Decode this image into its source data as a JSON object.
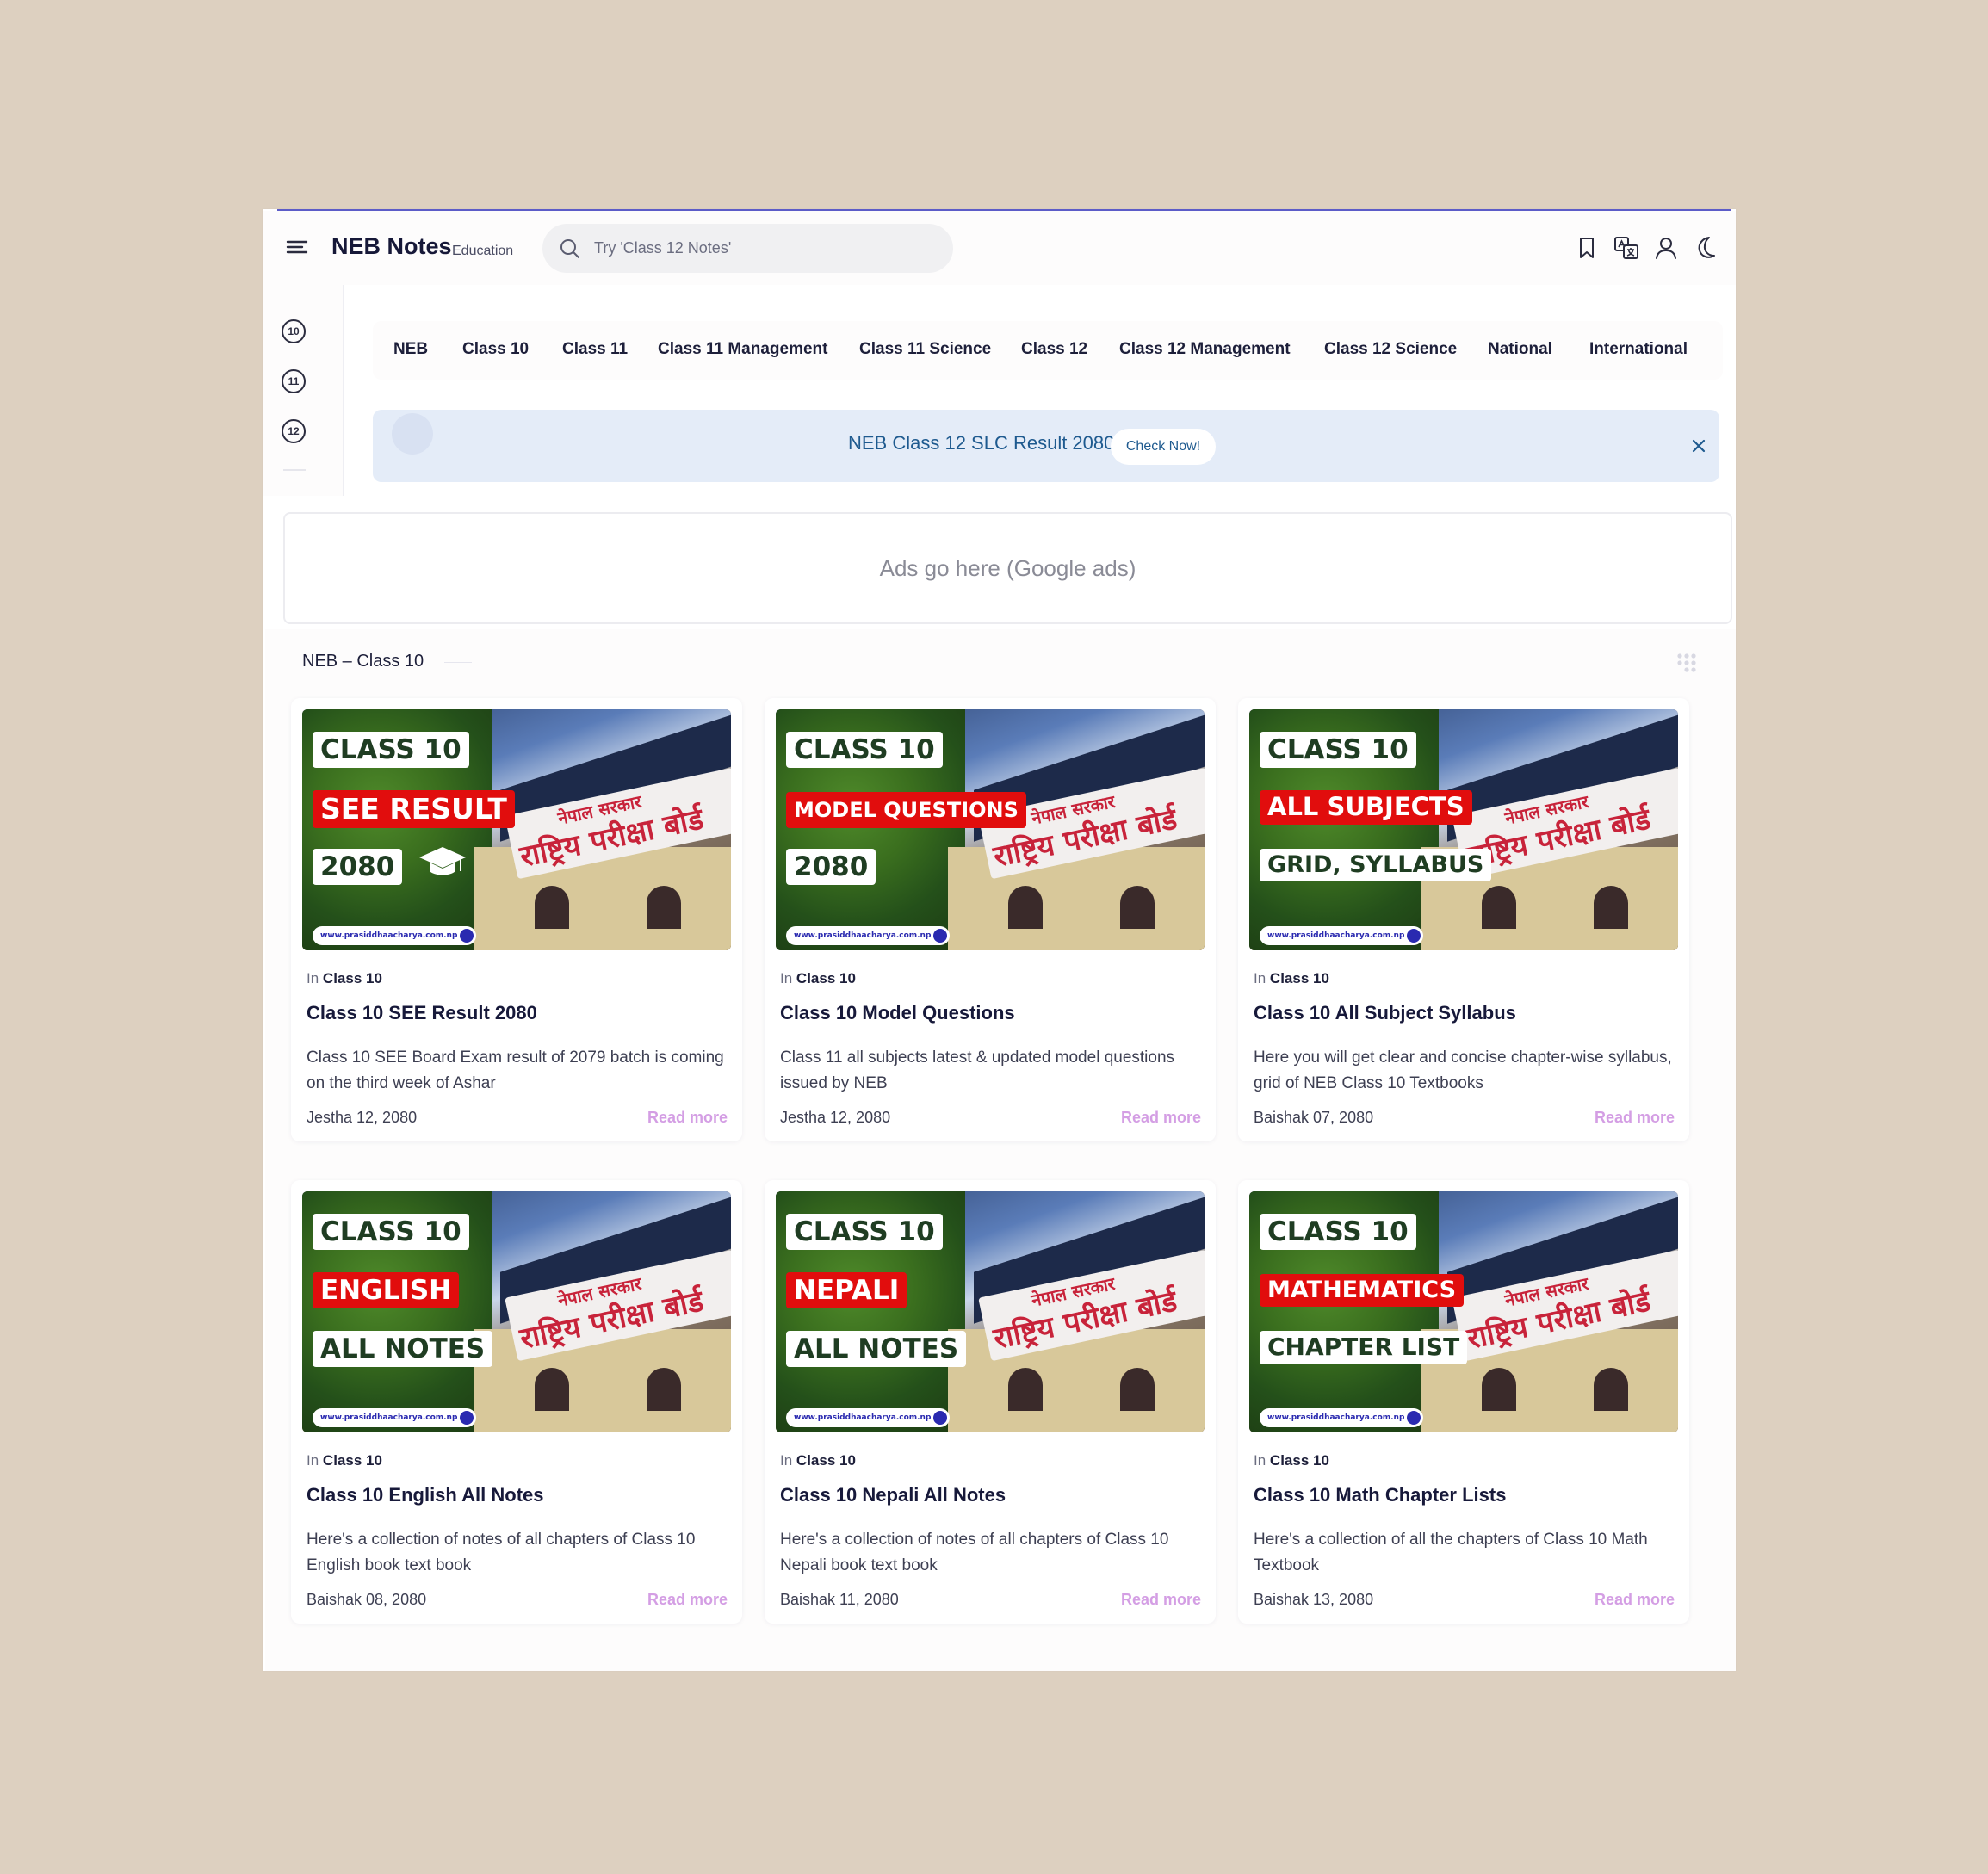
{
  "header": {
    "brand": "NEB Notes",
    "brand_sub": "Education",
    "search_placeholder": "Try 'Class 12 Notes'",
    "icons": [
      "bookmark-icon",
      "translate-icon",
      "user-icon",
      "moon-icon"
    ]
  },
  "sidebar": {
    "items": [
      {
        "label": "10"
      },
      {
        "label": "11"
      },
      {
        "label": "12"
      }
    ]
  },
  "nav": {
    "items": [
      {
        "label": "NEB"
      },
      {
        "label": "Class 10"
      },
      {
        "label": "Class 11"
      },
      {
        "label": "Class 11 Management"
      },
      {
        "label": "Class 11 Science"
      },
      {
        "label": "Class 12"
      },
      {
        "label": "Class 12 Management"
      },
      {
        "label": "Class 12 Science"
      },
      {
        "label": "National"
      },
      {
        "label": "International"
      }
    ]
  },
  "announcement": {
    "text": "NEB Class 12 SLC Result 2080",
    "button": "Check Now!",
    "accent": "#1e5a8f",
    "background": "#e4ecf8"
  },
  "ads": {
    "text": "Ads go here (Google ads)"
  },
  "breadcrumb": "NEB – Class 10",
  "cards": [
    {
      "thumb": {
        "line1": "CLASS 10",
        "line2": "SEE RESULT",
        "line3": "2080",
        "url": "www.prasiddhaacharya.com.np",
        "banner_top": "नेपाल सरकार",
        "banner_main": "राष्ट्रिय परीक्षा बोर्ड"
      },
      "cat_prefix": "In",
      "category": "Class 10",
      "title": "Class 10 SEE Result 2080",
      "desc": "Class 10 SEE Board Exam result of 2079 batch is coming on the third week of Ashar",
      "date": "Jestha 12, 2080",
      "more": "Read more"
    },
    {
      "thumb": {
        "line1": "CLASS 10",
        "line2": "MODEL QUESTIONS",
        "line3": "2080",
        "url": "www.prasiddhaacharya.com.np",
        "banner_top": "नेपाल सरकार",
        "banner_main": "राष्ट्रिय परीक्षा बोर्ड"
      },
      "cat_prefix": "In",
      "category": "Class 10",
      "title": "Class 10 Model Questions",
      "desc": "Class 11 all subjects latest & updated model questions issued by NEB",
      "date": "Jestha 12, 2080",
      "more": "Read more"
    },
    {
      "thumb": {
        "line1": "CLASS 10",
        "line2": "ALL SUBJECTS",
        "line3": "GRID, SYLLABUS",
        "url": "www.prasiddhaacharya.com.np",
        "banner_top": "नेपाल सरकार",
        "banner_main": "राष्ट्रिय परीक्षा बोर्ड"
      },
      "cat_prefix": "In",
      "category": "Class 10",
      "title": "Class 10 All Subject Syllabus",
      "desc": "Here you will get clear and concise chapter-wise syllabus, grid of NEB Class 10 Textbooks",
      "date": "Baishak 07, 2080",
      "more": "Read more"
    },
    {
      "thumb": {
        "line1": "CLASS 10",
        "line2": "ENGLISH",
        "line3": "ALL NOTES",
        "url": "www.prasiddhaacharya.com.np",
        "banner_top": "नेपाल सरकार",
        "banner_main": "राष्ट्रिय परीक्षा बोर्ड"
      },
      "cat_prefix": "In",
      "category": "Class 10",
      "title": "Class 10 English All Notes",
      "desc": "Here's a collection of notes of all chapters of Class 10 English book text book",
      "date": "Baishak 08, 2080",
      "more": "Read more"
    },
    {
      "thumb": {
        "line1": "CLASS 10",
        "line2": "NEPALI",
        "line3": "ALL NOTES",
        "url": "www.prasiddhaacharya.com.np",
        "banner_top": "नेपाल सरकार",
        "banner_main": "राष्ट्रिय परीक्षा बोर्ड"
      },
      "cat_prefix": "In",
      "category": "Class 10",
      "title": "Class 10 Nepali All Notes",
      "desc": "Here's a collection of notes of all chapters of Class 10 Nepali book text book",
      "date": "Baishak 11, 2080",
      "more": "Read more"
    },
    {
      "thumb": {
        "line1": "CLASS 10",
        "line2": "MATHEMATICS",
        "line3": "CHAPTER LIST",
        "url": "www.prasiddhaacharya.com.np",
        "banner_top": "नेपाल सरकार",
        "banner_main": "राष्ट्रिय परीक्षा बोर्ड"
      },
      "cat_prefix": "In",
      "category": "Class 10",
      "title": "Class 10 Math Chapter Lists",
      "desc": "Here's a collection of all the chapters of Class 10 Math Textbook",
      "date": "Baishak 13, 2080",
      "more": "Read more"
    }
  ],
  "colors": {
    "page_bg": "#ddd0c0",
    "read_more": "#d49ee4",
    "label_red": "#e10d0d",
    "label_green_text": "#1f3d22"
  }
}
